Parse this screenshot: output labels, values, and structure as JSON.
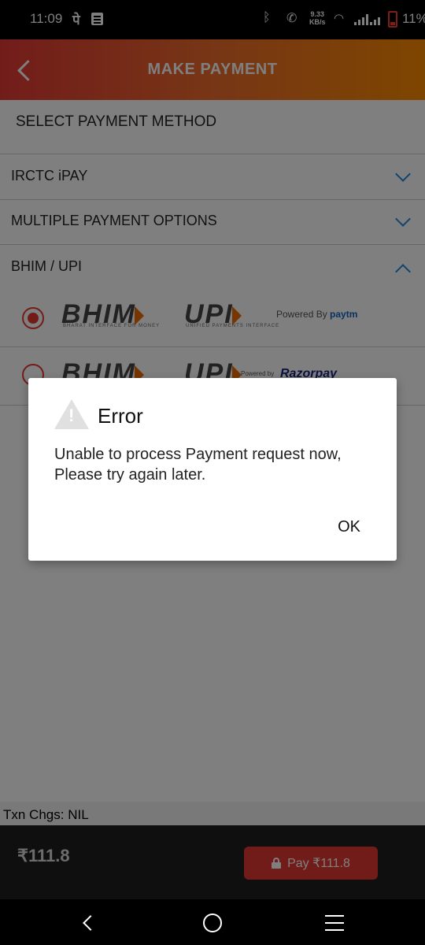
{
  "status_bar": {
    "time": "11:09",
    "carrier_icon": "पे",
    "speed_value": "9.33",
    "speed_unit": "KB/s",
    "battery_pct": "11%"
  },
  "header": {
    "title": "MAKE PAYMENT"
  },
  "section": {
    "title": "SELECT PAYMENT METHOD"
  },
  "payment_groups": [
    {
      "label": "IRCTC iPAY",
      "state": "collapsed"
    },
    {
      "label": "MULTIPLE PAYMENT OPTIONS",
      "state": "collapsed"
    },
    {
      "label": "BHIM / UPI",
      "state": "expanded"
    }
  ],
  "upi_options": [
    {
      "logo_text": "BHIM",
      "logo_text2": "UPI",
      "sub1": "BHARAT INTERFACE FOR MONEY",
      "sub2": "UNIFIED PAYMENTS INTERFACE",
      "powered_by_label": "Powered By",
      "provider": "paytm",
      "selected": true
    },
    {
      "logo_text": "BHIM",
      "logo_text2": "UPI",
      "powered_by_label": "Powered by",
      "provider": "Razorpay",
      "selected": false
    }
  ],
  "dialog": {
    "title": "Error",
    "message": "Unable to process Payment request now, Please try again later.",
    "ok_label": "OK"
  },
  "bottom": {
    "txn_charges": "Txn Chgs: NIL",
    "total": "₹111.8",
    "pay_label": "Pay ₹111.8"
  },
  "colors": {
    "accent_red": "#e53935",
    "header_orange": "#fb8c00",
    "link_blue": "#1e88e5"
  }
}
